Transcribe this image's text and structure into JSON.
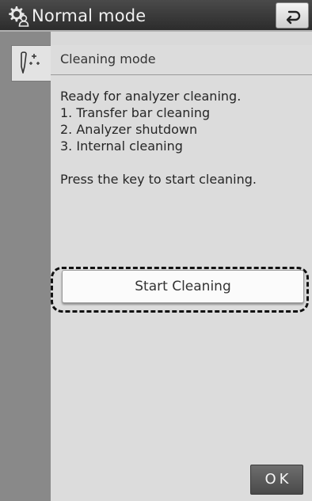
{
  "header": {
    "mode_icon": "gear-person-icon",
    "title": "Normal mode",
    "back_icon": "return-arrow-icon"
  },
  "sidebar": {
    "active_tab_icon": "cleaning-probe-icon"
  },
  "subheader": {
    "label": "Cleaning mode"
  },
  "message": {
    "lines": [
      "Ready for analyzer cleaning.",
      "1. Transfer bar cleaning",
      "2. Analyzer shutdown",
      "3. Internal cleaning"
    ],
    "instruction": "Press the key to start cleaning."
  },
  "buttons": {
    "start_cleaning": "Start Cleaning",
    "ok": "OK"
  },
  "colors": {
    "header_bg": "#2c2c2c",
    "sidebar_bg": "#898989",
    "content_bg": "#dcdcdc"
  }
}
